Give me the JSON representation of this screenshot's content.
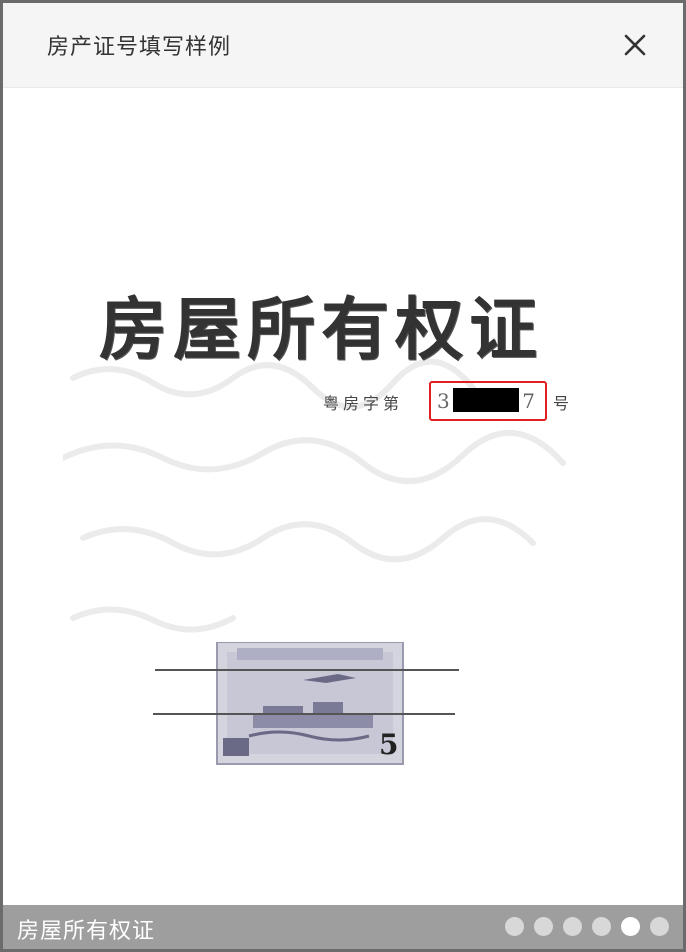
{
  "header": {
    "title": "房产证号填写样例",
    "close_icon": "close-icon"
  },
  "document": {
    "title": "房屋所有权证",
    "reg_prefix": "粤房字第",
    "reg_number_start": "3",
    "reg_number_end": "7",
    "reg_suffix": "号"
  },
  "footer": {
    "title": "房屋所有权证",
    "dots": [
      {
        "active": false
      },
      {
        "active": false
      },
      {
        "active": false
      },
      {
        "active": false
      },
      {
        "active": true
      },
      {
        "active": false
      }
    ]
  },
  "colors": {
    "highlight": "#e02020",
    "footer_bar": "#9e9e9e",
    "header_bar": "#f5f5f5"
  }
}
